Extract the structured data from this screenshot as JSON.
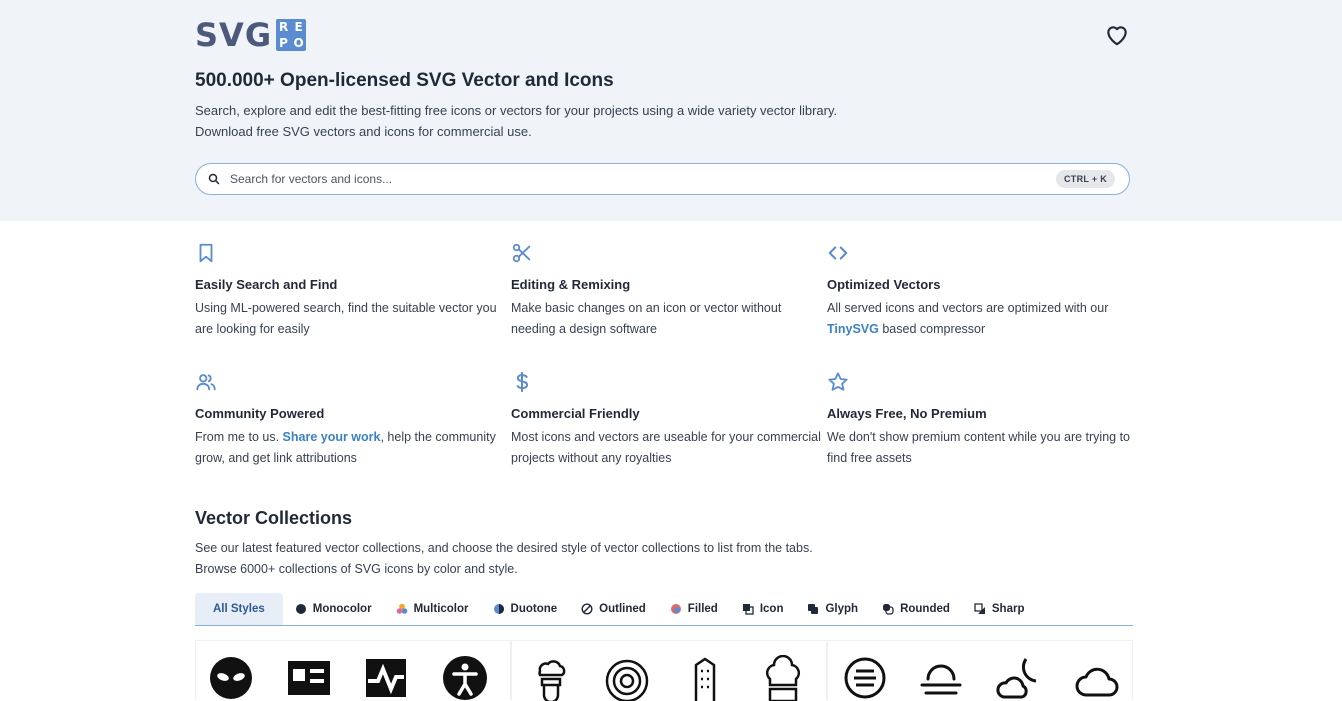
{
  "logo": {
    "text": "SVG",
    "badge": [
      "R",
      "E",
      "P",
      "O"
    ]
  },
  "header": {
    "favorites_icon": "heart-icon"
  },
  "hero": {
    "title": "500.000+ Open-licensed SVG Vector and Icons",
    "line1": "Search, explore and edit the best-fitting free icons or vectors for your projects using a wide variety vector library.",
    "line2": "Download free SVG vectors and icons for commercial use."
  },
  "search": {
    "placeholder": "Search for vectors and icons...",
    "shortcut": "CTRL + K",
    "icon": "search-icon"
  },
  "features": [
    {
      "icon": "bookmark-icon",
      "title": "Easily Search and Find",
      "text": "Using ML-powered search, find the suitable vector you are looking for easily"
    },
    {
      "icon": "scissors-icon",
      "title": "Editing & Remixing",
      "text": "Make basic changes on an icon or vector without needing a design software"
    },
    {
      "icon": "code-icon",
      "title": "Optimized Vectors",
      "text_before": "All served icons and vectors are optimized with our ",
      "link": "TinySVG",
      "text_after": " based compressor"
    },
    {
      "icon": "users-icon",
      "title": "Community Powered",
      "text_before": "From me to us. ",
      "link": "Share your work",
      "text_after": ", help the community grow, and get link attributions"
    },
    {
      "icon": "dollar-icon",
      "title": "Commercial Friendly",
      "text": "Most icons and vectors are useable for your commercial projects without any royalties"
    },
    {
      "icon": "star-icon",
      "title": "Always Free, No Premium",
      "text": "We don't show premium content while you are trying to find free assets"
    }
  ],
  "collections": {
    "title": "Vector Collections",
    "line1": "See our latest featured vector collections, and choose the desired style of vector collections to list from the tabs.",
    "line2": "Browse 6000+ collections of SVG icons by color and style.",
    "tabs": [
      "All Styles",
      "Monocolor",
      "Multicolor",
      "Duotone",
      "Outlined",
      "Filled",
      "Icon",
      "Glyph",
      "Rounded",
      "Sharp"
    ],
    "active_tab": "All Styles"
  },
  "colors": {
    "accent": "#5a8ccf",
    "link": "#3b82c4",
    "hero_bg": "#f0f3f8"
  }
}
